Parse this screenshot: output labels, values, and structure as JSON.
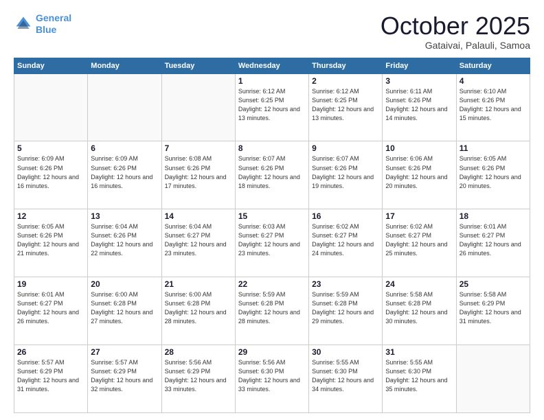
{
  "header": {
    "logo_line1": "General",
    "logo_line2": "Blue",
    "month": "October 2025",
    "location": "Gataivai, Palauli, Samoa"
  },
  "weekdays": [
    "Sunday",
    "Monday",
    "Tuesday",
    "Wednesday",
    "Thursday",
    "Friday",
    "Saturday"
  ],
  "weeks": [
    [
      {
        "day": "",
        "info": ""
      },
      {
        "day": "",
        "info": ""
      },
      {
        "day": "",
        "info": ""
      },
      {
        "day": "1",
        "info": "Sunrise: 6:12 AM\nSunset: 6:25 PM\nDaylight: 12 hours\nand 13 minutes."
      },
      {
        "day": "2",
        "info": "Sunrise: 6:12 AM\nSunset: 6:25 PM\nDaylight: 12 hours\nand 13 minutes."
      },
      {
        "day": "3",
        "info": "Sunrise: 6:11 AM\nSunset: 6:26 PM\nDaylight: 12 hours\nand 14 minutes."
      },
      {
        "day": "4",
        "info": "Sunrise: 6:10 AM\nSunset: 6:26 PM\nDaylight: 12 hours\nand 15 minutes."
      }
    ],
    [
      {
        "day": "5",
        "info": "Sunrise: 6:09 AM\nSunset: 6:26 PM\nDaylight: 12 hours\nand 16 minutes."
      },
      {
        "day": "6",
        "info": "Sunrise: 6:09 AM\nSunset: 6:26 PM\nDaylight: 12 hours\nand 16 minutes."
      },
      {
        "day": "7",
        "info": "Sunrise: 6:08 AM\nSunset: 6:26 PM\nDaylight: 12 hours\nand 17 minutes."
      },
      {
        "day": "8",
        "info": "Sunrise: 6:07 AM\nSunset: 6:26 PM\nDaylight: 12 hours\nand 18 minutes."
      },
      {
        "day": "9",
        "info": "Sunrise: 6:07 AM\nSunset: 6:26 PM\nDaylight: 12 hours\nand 19 minutes."
      },
      {
        "day": "10",
        "info": "Sunrise: 6:06 AM\nSunset: 6:26 PM\nDaylight: 12 hours\nand 20 minutes."
      },
      {
        "day": "11",
        "info": "Sunrise: 6:05 AM\nSunset: 6:26 PM\nDaylight: 12 hours\nand 20 minutes."
      }
    ],
    [
      {
        "day": "12",
        "info": "Sunrise: 6:05 AM\nSunset: 6:26 PM\nDaylight: 12 hours\nand 21 minutes."
      },
      {
        "day": "13",
        "info": "Sunrise: 6:04 AM\nSunset: 6:26 PM\nDaylight: 12 hours\nand 22 minutes."
      },
      {
        "day": "14",
        "info": "Sunrise: 6:04 AM\nSunset: 6:27 PM\nDaylight: 12 hours\nand 23 minutes."
      },
      {
        "day": "15",
        "info": "Sunrise: 6:03 AM\nSunset: 6:27 PM\nDaylight: 12 hours\nand 23 minutes."
      },
      {
        "day": "16",
        "info": "Sunrise: 6:02 AM\nSunset: 6:27 PM\nDaylight: 12 hours\nand 24 minutes."
      },
      {
        "day": "17",
        "info": "Sunrise: 6:02 AM\nSunset: 6:27 PM\nDaylight: 12 hours\nand 25 minutes."
      },
      {
        "day": "18",
        "info": "Sunrise: 6:01 AM\nSunset: 6:27 PM\nDaylight: 12 hours\nand 26 minutes."
      }
    ],
    [
      {
        "day": "19",
        "info": "Sunrise: 6:01 AM\nSunset: 6:27 PM\nDaylight: 12 hours\nand 26 minutes."
      },
      {
        "day": "20",
        "info": "Sunrise: 6:00 AM\nSunset: 6:28 PM\nDaylight: 12 hours\nand 27 minutes."
      },
      {
        "day": "21",
        "info": "Sunrise: 6:00 AM\nSunset: 6:28 PM\nDaylight: 12 hours\nand 28 minutes."
      },
      {
        "day": "22",
        "info": "Sunrise: 5:59 AM\nSunset: 6:28 PM\nDaylight: 12 hours\nand 28 minutes."
      },
      {
        "day": "23",
        "info": "Sunrise: 5:59 AM\nSunset: 6:28 PM\nDaylight: 12 hours\nand 29 minutes."
      },
      {
        "day": "24",
        "info": "Sunrise: 5:58 AM\nSunset: 6:28 PM\nDaylight: 12 hours\nand 30 minutes."
      },
      {
        "day": "25",
        "info": "Sunrise: 5:58 AM\nSunset: 6:29 PM\nDaylight: 12 hours\nand 31 minutes."
      }
    ],
    [
      {
        "day": "26",
        "info": "Sunrise: 5:57 AM\nSunset: 6:29 PM\nDaylight: 12 hours\nand 31 minutes."
      },
      {
        "day": "27",
        "info": "Sunrise: 5:57 AM\nSunset: 6:29 PM\nDaylight: 12 hours\nand 32 minutes."
      },
      {
        "day": "28",
        "info": "Sunrise: 5:56 AM\nSunset: 6:29 PM\nDaylight: 12 hours\nand 33 minutes."
      },
      {
        "day": "29",
        "info": "Sunrise: 5:56 AM\nSunset: 6:30 PM\nDaylight: 12 hours\nand 33 minutes."
      },
      {
        "day": "30",
        "info": "Sunrise: 5:55 AM\nSunset: 6:30 PM\nDaylight: 12 hours\nand 34 minutes."
      },
      {
        "day": "31",
        "info": "Sunrise: 5:55 AM\nSunset: 6:30 PM\nDaylight: 12 hours\nand 35 minutes."
      },
      {
        "day": "",
        "info": ""
      }
    ]
  ]
}
